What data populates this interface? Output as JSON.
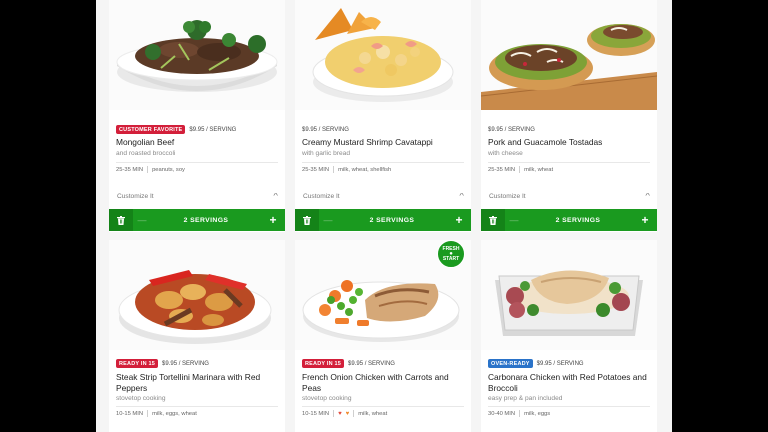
{
  "colors": {
    "green": "#1a9a1f",
    "customer_favorite": "#d31f3a",
    "ready_in_15": "#d31f3a",
    "oven_ready": "#2a73c9"
  },
  "meals": [
    {
      "name": "Mongolian Beef",
      "subtitle": "and roasted broccoli",
      "badge": "CUSTOMER FAVORITE",
      "badge_color": "#d31f3a",
      "price": "$9.95 / SERVING",
      "time": "25-35 MIN",
      "allergens": "peanuts, soy",
      "customize_label": "Customize It",
      "servings_label": "2 SERVINGS",
      "icon": "mongolian-beef-photo"
    },
    {
      "name": "Creamy Mustard Shrimp Cavatappi",
      "subtitle": "with garlic bread",
      "badge": "",
      "price": "$9.95 / SERVING",
      "time": "25-35 MIN",
      "allergens": "milk, wheat, shellfish",
      "customize_label": "Customize It",
      "servings_label": "2 SERVINGS",
      "icon": "shrimp-cavatappi-photo"
    },
    {
      "name": "Pork and Guacamole Tostadas",
      "subtitle": "with cheese",
      "badge": "",
      "price": "$9.95 / SERVING",
      "time": "25-35 MIN",
      "allergens": "milk, wheat",
      "customize_label": "Customize It",
      "servings_label": "2 SERVINGS",
      "icon": "tostadas-photo"
    },
    {
      "name": "Steak Strip Tortellini Marinara with Red Peppers",
      "subtitle": "stovetop cooking",
      "badge": "READY IN 15",
      "badge_color": "#d31f3a",
      "price": "$9.95 / SERVING",
      "time": "10-15 MIN",
      "allergens": "milk, eggs, wheat",
      "icon": "tortellini-photo"
    },
    {
      "name": "French Onion Chicken with Carrots and Peas",
      "subtitle": "stovetop cooking",
      "badge": "READY IN 15",
      "badge_color": "#d31f3a",
      "price": "$9.95 / SERVING",
      "time": "10-15 MIN",
      "allergens": "milk, wheat",
      "fresh_start": [
        "FRESH",
        "START"
      ],
      "icon": "french-onion-chicken-photo"
    },
    {
      "name": "Carbonara Chicken with Red Potatoes and Broccoli",
      "subtitle": "easy prep & pan included",
      "badge": "OVEN-READY",
      "badge_color": "#2a73c9",
      "price": "$9.95 / SERVING",
      "time": "30-40 MIN",
      "allergens": "milk, eggs",
      "icon": "carbonara-chicken-photo"
    }
  ]
}
